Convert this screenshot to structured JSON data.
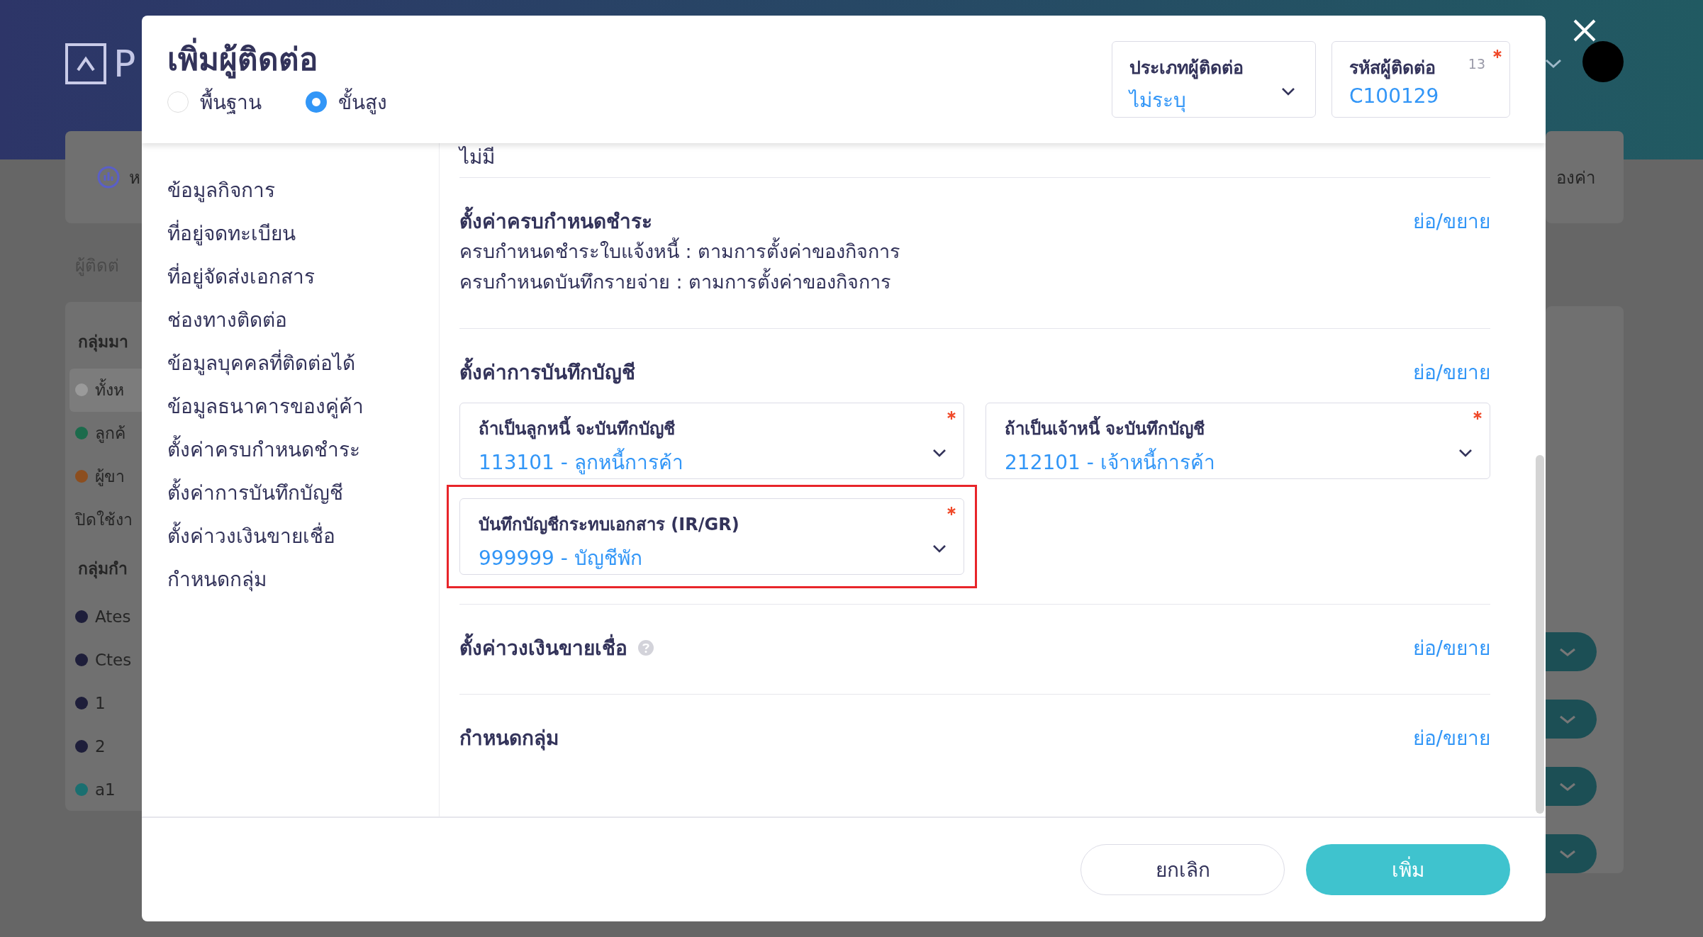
{
  "background": {
    "logo_letter": "P",
    "card_text": "ห",
    "breadcrumb": "ผู้ติดต่",
    "right_card_text": "องค่า",
    "panel": [
      {
        "kind": "heading",
        "label": "กลุ่มมา"
      },
      {
        "kind": "dot",
        "label": "ทั้งห",
        "color": "#9a9a9a",
        "selected": true
      },
      {
        "kind": "dot",
        "label": "ลูกค้",
        "color": "#1c6b4c",
        "selected": false
      },
      {
        "kind": "dot",
        "label": "ผู้ขา",
        "color": "#8c4e1f",
        "selected": false
      },
      {
        "kind": "plain",
        "label": "ปิดใช้งา"
      },
      {
        "kind": "heading",
        "label": "กลุ่มกำ"
      },
      {
        "kind": "dot",
        "label": "Ates",
        "color": "#1e1e3a",
        "selected": false
      },
      {
        "kind": "dot",
        "label": "Ctes",
        "color": "#1e1e3a",
        "selected": false
      },
      {
        "kind": "dot",
        "label": "1",
        "color": "#1e1e3a",
        "selected": false
      },
      {
        "kind": "dot",
        "label": "2",
        "color": "#1e1e3a",
        "selected": false
      },
      {
        "kind": "dot",
        "label": "a1",
        "color": "#1a6f70",
        "selected": false
      }
    ]
  },
  "modal": {
    "title": "เพิ่มผู้ติดต่อ",
    "modes": [
      {
        "label": "พื้นฐาน",
        "selected": false
      },
      {
        "label": "ขั้นสูง",
        "selected": true
      }
    ],
    "contact_type": {
      "label": "ประเภทผู้ติดต่อ",
      "value": "ไม่ระบุ"
    },
    "contact_code": {
      "label": "รหัสผู้ติดต่อ",
      "counter": "13",
      "value": "C100129",
      "required": true
    },
    "nav": [
      "ข้อมูลกิจการ",
      "ที่อยู่จดทะเบียน",
      "ที่อยู่จัดส่งเอกสาร",
      "ช่องทางติดต่อ",
      "ข้อมูลบุคคลที่ติดต่อได้",
      "ข้อมูลธนาคารของคู่ค้า",
      "ตั้งค่าครบกำหนดชำระ",
      "ตั้งค่าการบันทึกบัญชี",
      "ตั้งค่าวงเงินขายเชื่อ",
      "กำหนดกลุ่ม"
    ],
    "top_text": "ไม่มี",
    "sections": [
      {
        "kind": "lines",
        "title": "ตั้งค่าครบกำหนดชำระ",
        "toggle": "ย่อ/ขยาย",
        "lines": [
          "ครบกำหนดชำระใบแจ้งหนี้ : ตามการตั้งค่าของกิจการ",
          "ครบกำหนดบันทึกรายจ่าย : ตามการตั้งค่าของกิจการ"
        ]
      },
      {
        "kind": "fields",
        "title": "ตั้งค่าการบันทึกบัญชี",
        "toggle": "ย่อ/ขยาย",
        "fields": [
          {
            "label": "ถ้าเป็นลูกหนี้ จะบันทึกบัญชี",
            "value": "113101 - ลูกหนี้การค้า",
            "required": true,
            "highlighted": false
          },
          {
            "label": "ถ้าเป็นเจ้าหนี้ จะบันทึกบัญชี",
            "value": "212101 - เจ้าหนี้การค้า",
            "required": true,
            "highlighted": false
          },
          {
            "label": "บันทึกบัญชีกระทบเอกสาร (IR/GR)",
            "value": "999999 - บัญชีพัก",
            "required": true,
            "highlighted": true
          }
        ]
      },
      {
        "kind": "collapsed",
        "title": "ตั้งค่าวงเงินขายเชื่อ",
        "toggle": "ย่อ/ขยาย",
        "help": true
      },
      {
        "kind": "collapsed",
        "title": "กำหนดกลุ่ม",
        "toggle": "ย่อ/ขยาย",
        "help": false
      }
    ],
    "buttons": [
      {
        "kind": "secondary",
        "label": "ยกเลิก"
      },
      {
        "kind": "primary",
        "label": "เพิ่ม"
      }
    ]
  }
}
